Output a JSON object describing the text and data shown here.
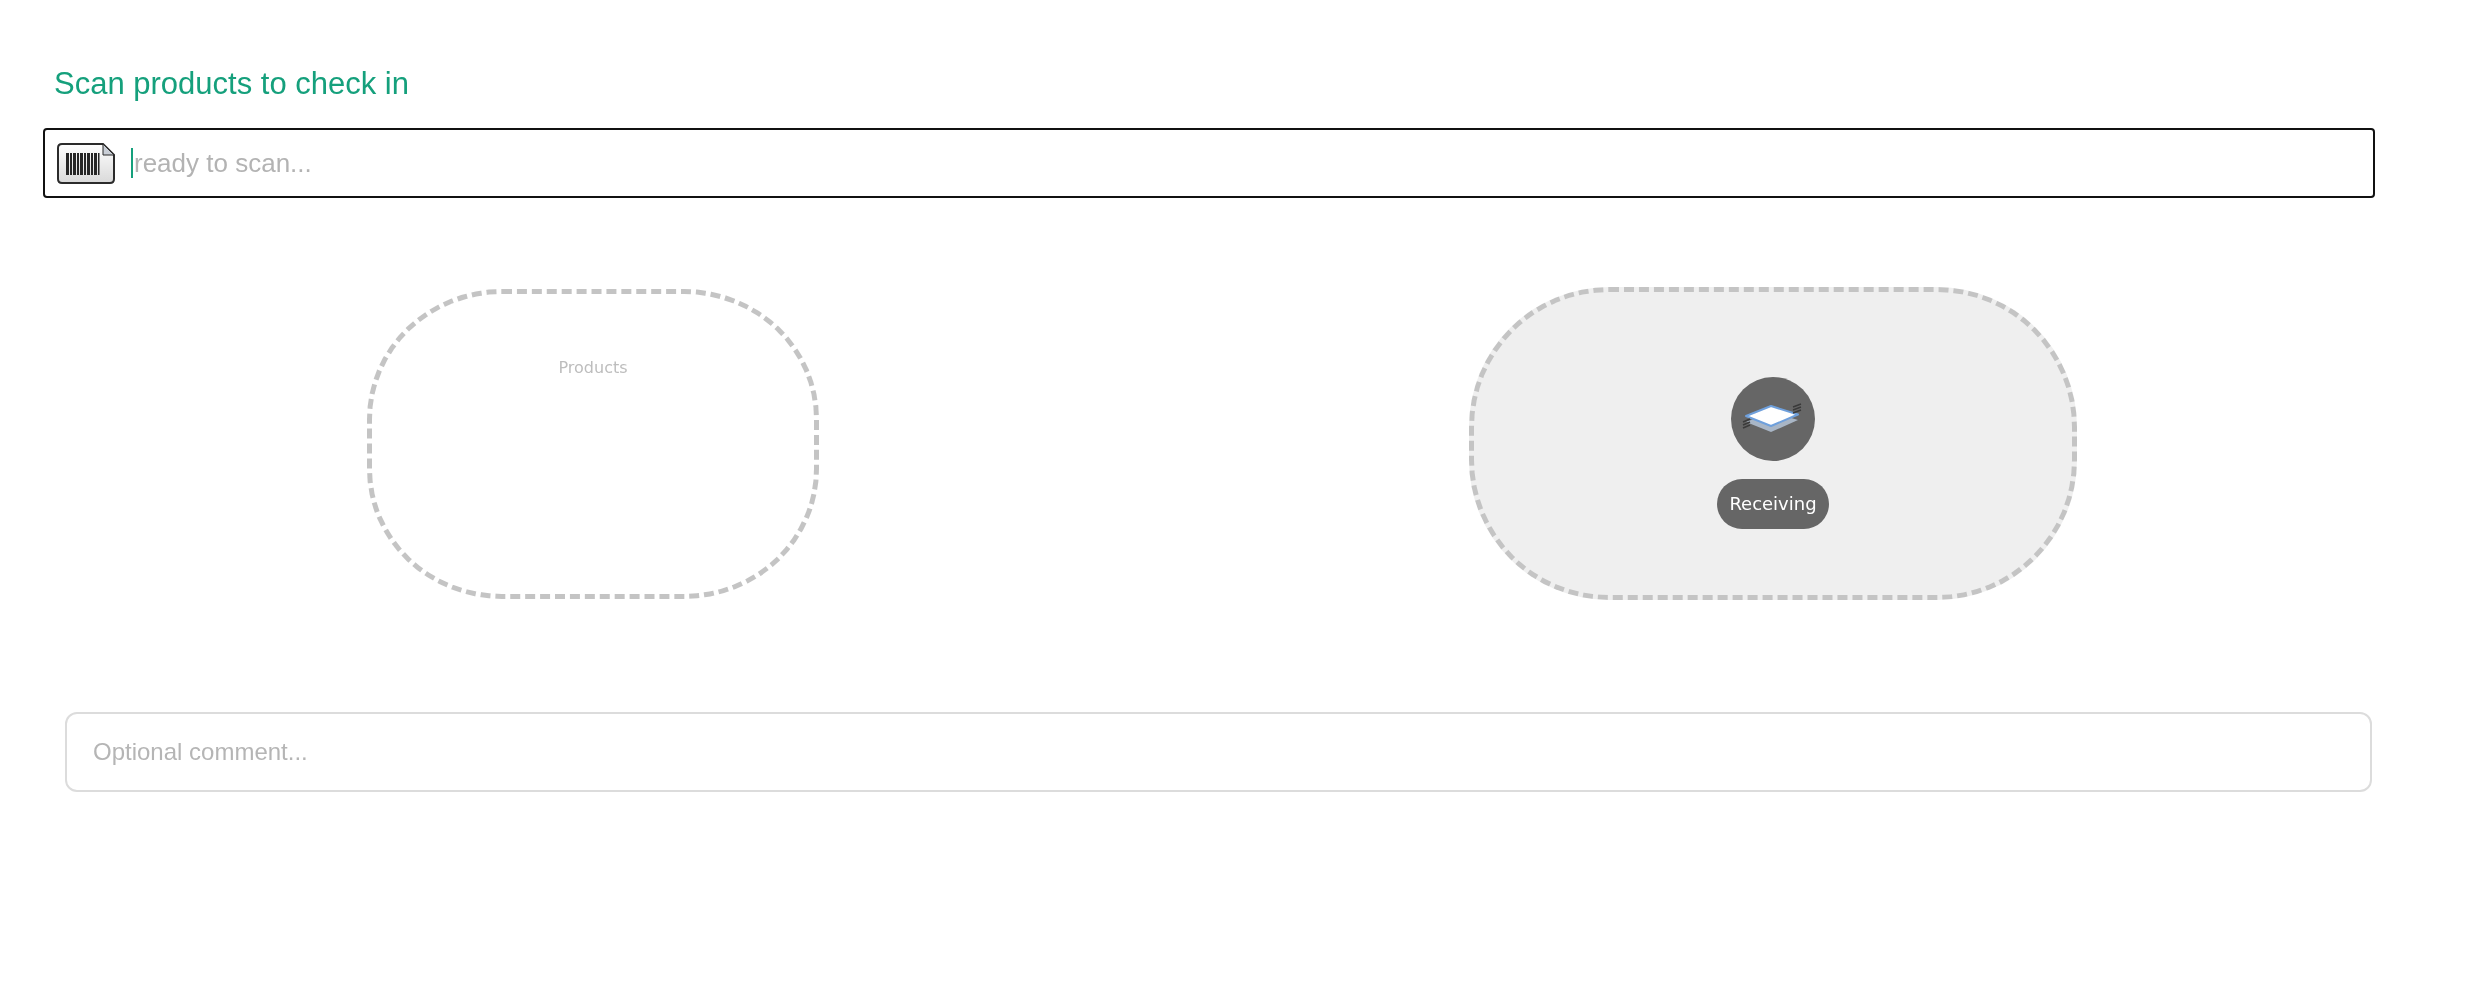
{
  "heading": "Scan products to check in",
  "scan_field": {
    "placeholder": "ready to scan...",
    "focused": true
  },
  "drop_zones": [
    {
      "kind": "placeholder",
      "label": "Products"
    },
    {
      "kind": "location",
      "label": "Receiving"
    }
  ],
  "comment": {
    "placeholder": "Optional comment..."
  }
}
